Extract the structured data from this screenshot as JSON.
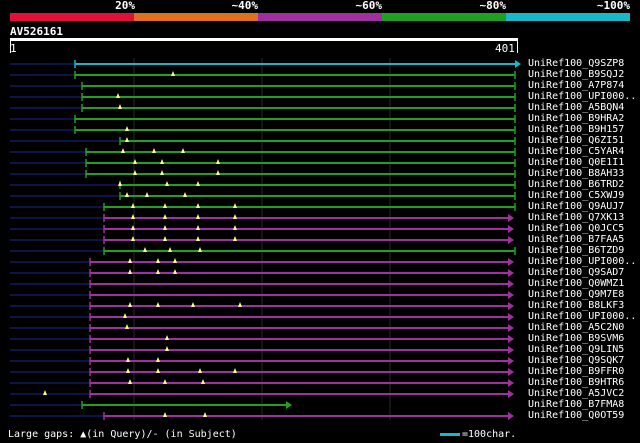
{
  "legend": [
    {
      "label": "20%",
      "color": "#e0103a"
    },
    {
      "label": "~40%",
      "color": "#e07020"
    },
    {
      "label": "~60%",
      "color": "#a030a0"
    },
    {
      "label": "~80%",
      "color": "#20a020"
    },
    {
      "label": "~100%",
      "color": "#18b8c8"
    }
  ],
  "query": {
    "id": "AV526161",
    "start": "1",
    "end": "401"
  },
  "hits": [
    {
      "name": "UniRef100_Q9SZP8",
      "color": "#18b8c8",
      "start": 75,
      "end": 515,
      "arrow": true,
      "tri": []
    },
    {
      "name": "UniRef100_B9SQJ2",
      "color": "#20a020",
      "start": 75,
      "end": 515,
      "arrow": false,
      "tri": [
        173
      ]
    },
    {
      "name": "UniRef100_A7P874",
      "color": "#20a020",
      "start": 82,
      "end": 515,
      "arrow": false,
      "tri": []
    },
    {
      "name": "UniRef100_UPI000..",
      "color": "#20a020",
      "start": 82,
      "end": 515,
      "arrow": false,
      "tri": [
        118
      ]
    },
    {
      "name": "UniRef100_A5BQN4",
      "color": "#20a020",
      "start": 82,
      "end": 515,
      "arrow": false,
      "tri": [
        120
      ]
    },
    {
      "name": "UniRef100_B9HRA2",
      "color": "#20a020",
      "start": 75,
      "end": 515,
      "arrow": false,
      "tri": []
    },
    {
      "name": "UniRef100_B9H157",
      "color": "#20a020",
      "start": 75,
      "end": 515,
      "arrow": false,
      "tri": [
        127
      ]
    },
    {
      "name": "UniRef100_Q6ZI51",
      "color": "#20a020",
      "start": 120,
      "end": 515,
      "arrow": false,
      "tri": [
        127
      ]
    },
    {
      "name": "UniRef100_C5YAR4",
      "color": "#20a020",
      "start": 86,
      "end": 515,
      "arrow": false,
      "tri": [
        123,
        154,
        183
      ]
    },
    {
      "name": "UniRef100_Q0E1I1",
      "color": "#20a020",
      "start": 86,
      "end": 515,
      "arrow": false,
      "tri": [
        135,
        162,
        218
      ]
    },
    {
      "name": "UniRef100_B8AH33",
      "color": "#20a020",
      "start": 86,
      "end": 515,
      "arrow": false,
      "tri": [
        135,
        162,
        218
      ]
    },
    {
      "name": "UniRef100_B6TRD2",
      "color": "#20a020",
      "start": 120,
      "end": 515,
      "arrow": false,
      "tri": [
        120,
        167,
        198
      ]
    },
    {
      "name": "UniRef100_C5XWJ9",
      "color": "#20a020",
      "start": 120,
      "end": 515,
      "arrow": false,
      "tri": [
        127,
        147,
        185
      ]
    },
    {
      "name": "UniRef100_Q9AUJ7",
      "color": "#20a020",
      "start": 104,
      "end": 515,
      "arrow": false,
      "tri": [
        133,
        165,
        198,
        235
      ]
    },
    {
      "name": "UniRef100_Q7XK13",
      "color": "#a030a0",
      "start": 104,
      "end": 508,
      "arrow": true,
      "tri": [
        133,
        165,
        198,
        235
      ]
    },
    {
      "name": "UniRef100_Q0JCC5",
      "color": "#a030a0",
      "start": 104,
      "end": 508,
      "arrow": true,
      "tri": [
        133,
        165,
        198,
        235
      ]
    },
    {
      "name": "UniRef100_B7FAA5",
      "color": "#a030a0",
      "start": 104,
      "end": 508,
      "arrow": true,
      "tri": [
        133,
        165,
        198,
        235
      ]
    },
    {
      "name": "UniRef100_B6TZD9",
      "color": "#20a020",
      "start": 104,
      "end": 515,
      "arrow": false,
      "tri": [
        145,
        170,
        200
      ]
    },
    {
      "name": "UniRef100_UPI000..",
      "color": "#a030a0",
      "start": 90,
      "end": 508,
      "arrow": true,
      "tri": [
        130,
        158,
        175
      ]
    },
    {
      "name": "UniRef100_Q9SAD7",
      "color": "#a030a0",
      "start": 90,
      "end": 508,
      "arrow": true,
      "tri": [
        130,
        158,
        175
      ]
    },
    {
      "name": "UniRef100_Q0WMZ1",
      "color": "#a030a0",
      "start": 90,
      "end": 508,
      "arrow": true,
      "tri": []
    },
    {
      "name": "UniRef100_Q9M7E8",
      "color": "#a030a0",
      "start": 90,
      "end": 508,
      "arrow": true,
      "tri": []
    },
    {
      "name": "UniRef100_B8LKF3",
      "color": "#a030a0",
      "start": 90,
      "end": 508,
      "arrow": true,
      "tri": [
        130,
        158,
        193,
        240
      ]
    },
    {
      "name": "UniRef100_UPI000..",
      "color": "#a030a0",
      "start": 90,
      "end": 508,
      "arrow": true,
      "tri": [
        125
      ]
    },
    {
      "name": "UniRef100_A5C2N0",
      "color": "#a030a0",
      "start": 90,
      "end": 508,
      "arrow": true,
      "tri": [
        127
      ]
    },
    {
      "name": "UniRef100_B9SVM6",
      "color": "#a030a0",
      "start": 90,
      "end": 508,
      "arrow": true,
      "tri": [
        167
      ]
    },
    {
      "name": "UniRef100_Q9LIN5",
      "color": "#a030a0",
      "start": 90,
      "end": 508,
      "arrow": true,
      "tri": [
        167
      ]
    },
    {
      "name": "UniRef100_Q9SQK7",
      "color": "#a030a0",
      "start": 90,
      "end": 508,
      "arrow": true,
      "tri": [
        128,
        158
      ]
    },
    {
      "name": "UniRef100_B9FFR0",
      "color": "#a030a0",
      "start": 90,
      "end": 508,
      "arrow": true,
      "tri": [
        128,
        158,
        200,
        235
      ]
    },
    {
      "name": "UniRef100_B9HTR6",
      "color": "#a030a0",
      "start": 90,
      "end": 508,
      "arrow": true,
      "tri": [
        130,
        165,
        203
      ]
    },
    {
      "name": "UniRef100_A5JVC2",
      "color": "#a030a0",
      "start": 90,
      "end": 508,
      "arrow": true,
      "tri": [
        45
      ]
    },
    {
      "name": "UniRef100_B7FMA8",
      "color": "#20a020",
      "start": 82,
      "end": 286,
      "arrow": true,
      "tri": []
    },
    {
      "name": "UniRef100_Q0OT59",
      "color": "#a030a0",
      "start": 104,
      "end": 508,
      "arrow": true,
      "tri": [
        165,
        205
      ]
    }
  ],
  "footer": {
    "text": "Large gaps: ▲(in Query)/- (in Subject)"
  },
  "scale": {
    "text": "=100char."
  }
}
